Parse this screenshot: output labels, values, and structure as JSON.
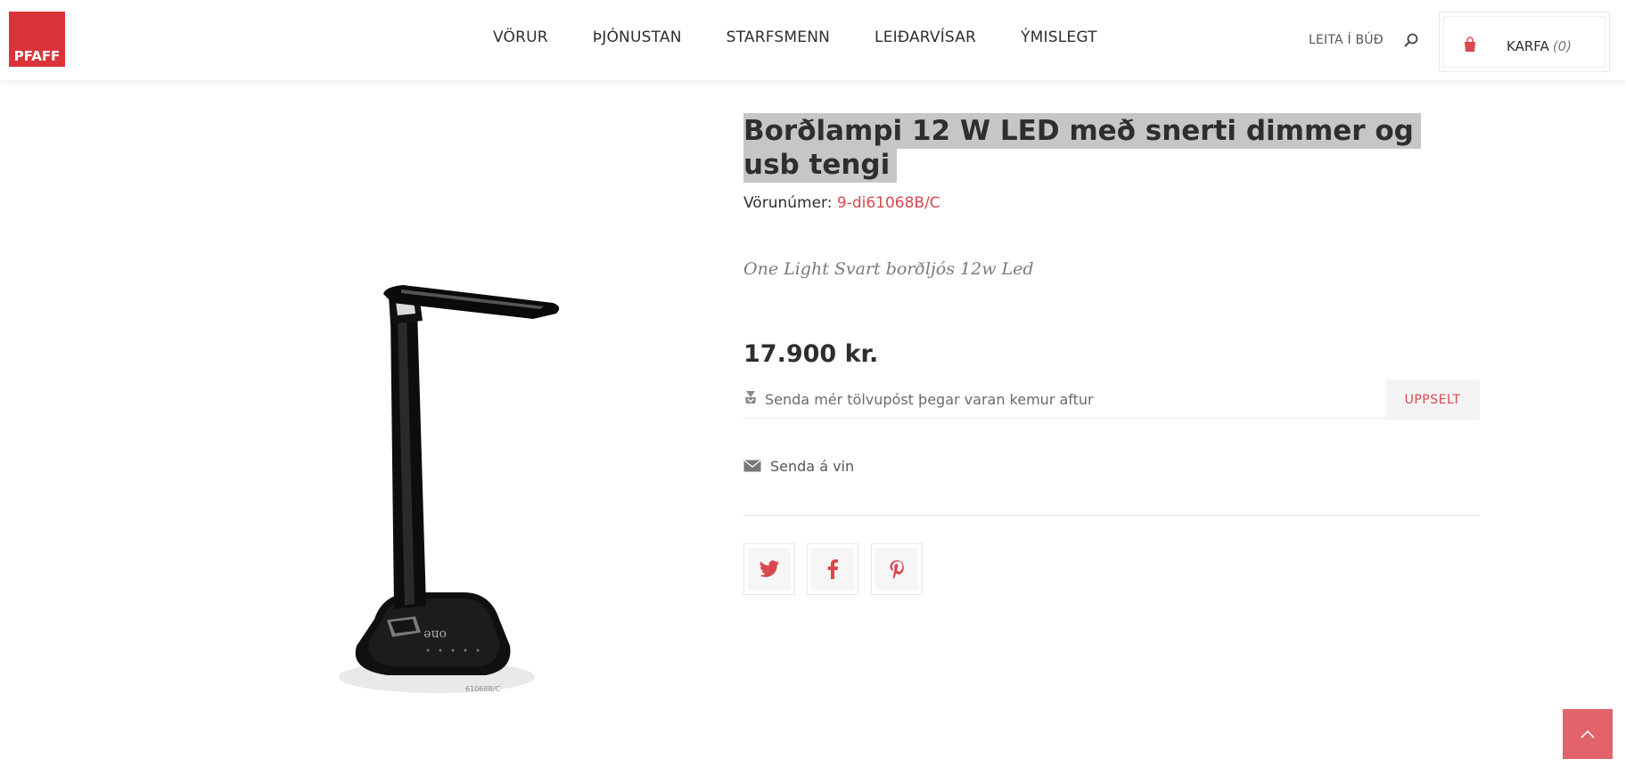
{
  "header": {
    "logo_text": "PFAFF",
    "nav": [
      "VÖRUR",
      "ÞJÓNUSTAN",
      "STARFSMENN",
      "LEIÐARVÍSAR",
      "ÝMISLEGT"
    ],
    "search_label": "LEITA Í BÚÐ",
    "cart_label": "KARFA",
    "cart_count": "(0)"
  },
  "product": {
    "title": "Borðlampi 12 W LED með snerti dimmer og usb tengi",
    "sku_label": "Vörunúmer:",
    "sku_value": "9-di61068B/C",
    "description": "One Light Svart borðljós 12w Led",
    "price": "17.900 kr.",
    "notify_text": "Senda mér tölvupóst þegar varan kemur aftur",
    "soldout_label": "UPPSELT",
    "send_friend_label": "Senda á vin",
    "image_caption": "61068B/C",
    "lamp_brand": "one"
  },
  "colors": {
    "accent": "#d9343b",
    "link": "#d9474f",
    "back_to_top": "#e2636a"
  },
  "icons": [
    "search-icon",
    "shopping-bag-icon",
    "bell-icon",
    "envelope-icon",
    "twitter-icon",
    "facebook-icon",
    "pinterest-icon",
    "chevron-up-icon"
  ]
}
